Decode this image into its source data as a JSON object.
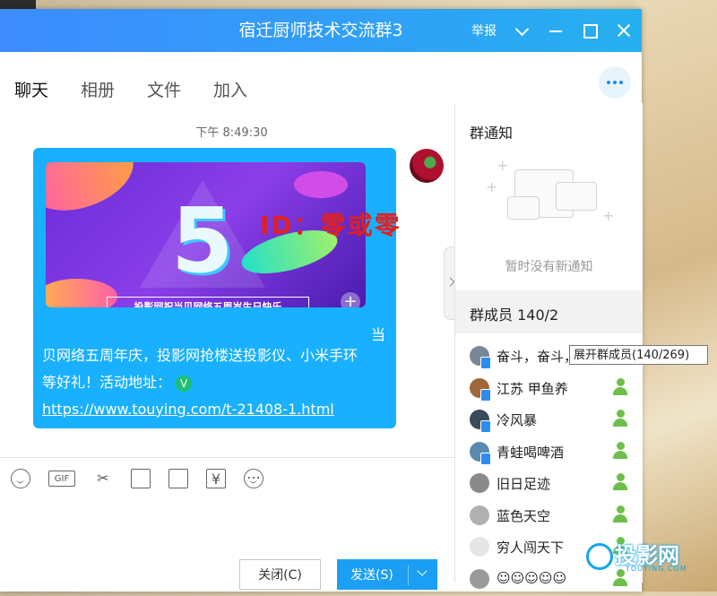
{
  "window": {
    "title": "宿迁厨师技术交流群3",
    "report_label": "举报",
    "titlebar_gradient": [
      "#3d8bff",
      "#26b0f0"
    ]
  },
  "tabs": [
    {
      "label": "聊天",
      "active": true
    },
    {
      "label": "相册",
      "active": false
    },
    {
      "label": "文件",
      "active": false
    },
    {
      "label": "加入",
      "active": false
    }
  ],
  "chat": {
    "timestamp": "下午 8:49:30",
    "banner_number": "5",
    "banner_caption": "投影网祝当贝网络五周岁生日快乐",
    "watermark": "ID：零或零",
    "trailing_char": "当",
    "message_line1": "贝网络五周年庆，投影网抢楼送投影仪、小米手环",
    "message_line2": "等好礼！活动地址：",
    "verified_icon": "V",
    "link": "https://www.touying.com/t-21408-1.html",
    "bubble_color": "#19b0ff"
  },
  "toolbar_icons": [
    "smile-icon",
    "gif-icon",
    "scissors-icon",
    "screenshot-icon",
    "image-icon",
    "red-packet-icon",
    "more-icon"
  ],
  "toolbar": {
    "gif_label": "GIF",
    "red_packet_glyph": "¥",
    "more_glyph": "⋯"
  },
  "buttons": {
    "close_label": "关闭(C)",
    "send_label": "发送(S)"
  },
  "sidebar": {
    "notice_title": "群通知",
    "notice_empty": "暂时没有新通知",
    "members_title": "群成员 140/2",
    "tooltip": "展开群成员(140/269)",
    "members": [
      {
        "name": "奋斗，奋斗，",
        "role": false
      },
      {
        "name": "江苏       甲鱼养",
        "role": true
      },
      {
        "name": "冷风暴",
        "role": true
      },
      {
        "name": "青蛙喝啤酒",
        "role": true
      },
      {
        "name": "旧日足迹",
        "role": true
      },
      {
        "name": "蓝色天空",
        "role": true
      },
      {
        "name": "穷人闯天下",
        "role": true
      },
      {
        "name": "☺☺☺☺☺",
        "role": true
      }
    ]
  },
  "brand": {
    "logo_text": "投影网",
    "logo_sub": "TOUYING.COM",
    "accent": "#16a5e8"
  }
}
